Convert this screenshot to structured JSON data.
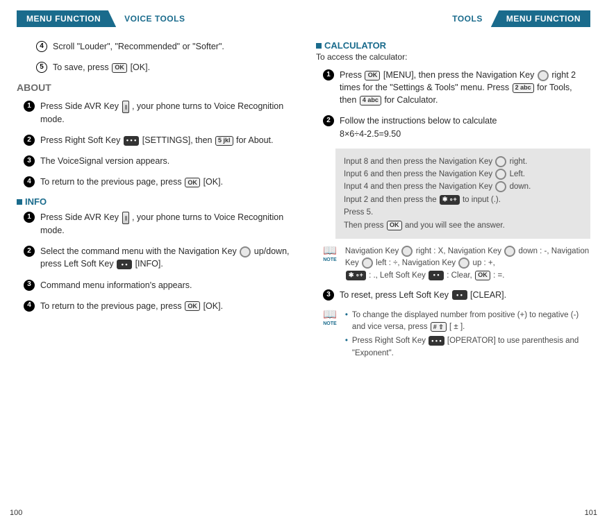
{
  "left": {
    "tab": "MENU FUNCTION",
    "section": "VOICE TOOLS",
    "steps_top": {
      "s4": "Scroll \"Louder\", \"Recommended\" or \"Softer\".",
      "s5a": "To save, press",
      "s5b": "[OK]."
    },
    "about": {
      "heading": "ABOUT",
      "s1a": "Press Side AVR Key",
      "s1b": ", your phone turns to Voice Recognition mode.",
      "s2a": "Press Right Soft Key",
      "s2b": "[SETTINGS], then",
      "s2c": "for About.",
      "s3": "The VoiceSignal version appears.",
      "s4a": "To return to the previous page, press",
      "s4b": "[OK]."
    },
    "info": {
      "heading": "INFO",
      "s1a": "Press Side AVR Key",
      "s1b": ", your phone turns to Voice Recognition mode.",
      "s2a": "Select the command menu with the Navigation Key",
      "s2b": "up/down, press Left Soft Key",
      "s2c": "[INFO].",
      "s3": "Command menu information's appears.",
      "s4a": "To return to the previous page, press",
      "s4b": "[OK]."
    },
    "pagenum": "100"
  },
  "right": {
    "section": "TOOLS",
    "tab": "MENU FUNCTION",
    "calc": {
      "heading": "CALCULATOR",
      "sub": "To access the calculator:",
      "s1a": "Press",
      "s1b": "[MENU], then press the Navigation Key",
      "s1c": "right 2 times for the \"Settings & Tools\" menu. Press",
      "s1d": "for Tools, then",
      "s1e": "for Calculator.",
      "s2a": "Follow the instructions below to calculate",
      "s2b": "8×6÷4-2.5=9.50",
      "example": {
        "l1a": "Input 8 and then press the Navigation Key",
        "l1b": "right.",
        "l2a": "Input 6 and then press the Navigation Key",
        "l2b": "Left.",
        "l3a": "Input 4 and then press the Navigation Key",
        "l3b": "down.",
        "l4a": "Input 2 and then press the",
        "l4b": "to input (.).",
        "l5": "Press 5.",
        "l6a": "Then press",
        "l6b": "and you will see the answer."
      },
      "note1a": "Navigation Key",
      "note1b": "right : X, Navigation Key",
      "note1c": "down : -,",
      "note1d": "Navigation Key",
      "note1e": "left : ÷, Navigation Key",
      "note1f": "up : +,",
      "note1g": ": ., Left Soft Key",
      "note1h": ": Clear,",
      "note1i": ": =.",
      "s3a": "To reset, press Left Soft Key",
      "s3b": "[CLEAR].",
      "note2_li1a": "To change the displayed number from positive (+) to negative (-) and vice versa, press",
      "note2_li1b": "[ ± ].",
      "note2_li2a": "Press Right Soft Key",
      "note2_li2b": "[OPERATOR] to use parenthesis and \"Exponent\"."
    },
    "pagenum": "101"
  },
  "icons": {
    "ok": "OK",
    "dots": "• •",
    "dots3": "• • •",
    "five": "5 jkl",
    "two": "2 abc",
    "four": "4 abc",
    "star": "✱ ∘+",
    "hash": "# ⇧",
    "note": "NOTE"
  }
}
